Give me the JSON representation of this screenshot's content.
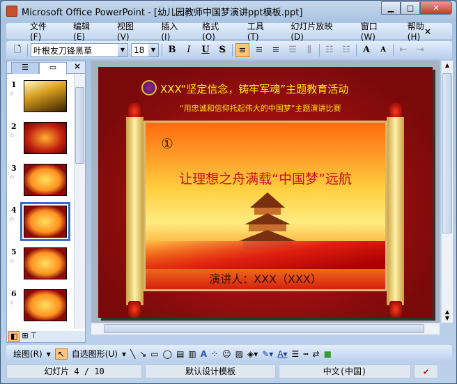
{
  "window": {
    "title": "Microsoft Office PowerPoint - [幼儿园教师中国梦演讲ppt模板.ppt]",
    "minimize": "▁",
    "maximize": "□",
    "close": "✕"
  },
  "menu": [
    "文件(F)",
    "编辑(E)",
    "视图(V)",
    "插入(I)",
    "格式(O)",
    "工具(T)",
    "幻灯片放映(D)",
    "窗口(W)",
    "帮助(H)"
  ],
  "menu_close": "×",
  "format": {
    "font": "叶根友刀锋黑草",
    "size": "18",
    "bold": "B",
    "italic": "I",
    "underline": "U",
    "shadow": "S",
    "grow": "A",
    "shrink": "A"
  },
  "pane": {
    "close": "×",
    "slides": [
      {
        "n": "1"
      },
      {
        "n": "2"
      },
      {
        "n": "3"
      },
      {
        "n": "4",
        "selected": true
      },
      {
        "n": "5"
      },
      {
        "n": "6"
      }
    ]
  },
  "slide": {
    "header": "XXX“坚定信念，铸牢军魂”主题教育活动",
    "subheader": "“用忠诚和信仰托起伟大的中国梦”主题演讲比赛",
    "marker": "①",
    "title": "让理想之舟满载“中国梦”远航",
    "speaker": "演讲人：XXX（XXX）"
  },
  "drawing": {
    "draw": "绘图(R)",
    "autoshapes": "自选图形(U)"
  },
  "status": {
    "slide": "幻灯片 4 / 10",
    "template": "默认设计模板",
    "language": "中文(中国)"
  }
}
